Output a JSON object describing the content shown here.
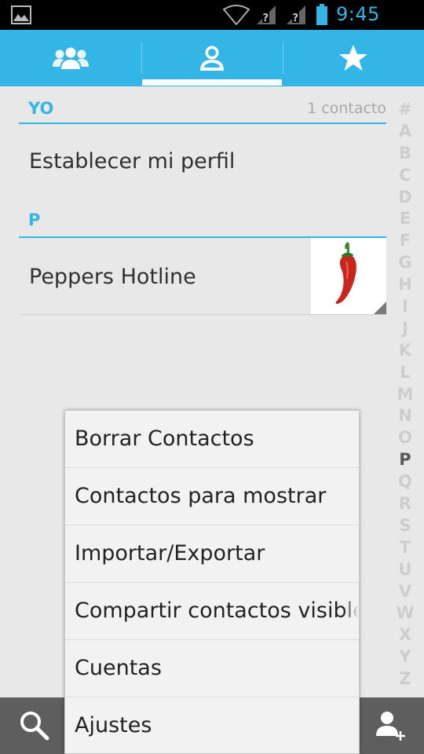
{
  "status_bar": {
    "time": "9:45 p.m.",
    "icons": [
      "gallery-icon",
      "wifi-icon",
      "signal-icon",
      "signal-icon",
      "battery-icon"
    ],
    "time_color": "#33b5e5"
  },
  "tabs": [
    {
      "name": "groups",
      "icon": "group-icon",
      "selected": false
    },
    {
      "name": "all-contacts",
      "icon": "person-icon",
      "selected": true
    },
    {
      "name": "favorites",
      "icon": "star-icon",
      "selected": false
    }
  ],
  "colors": {
    "accent": "#33b5e5",
    "bottom_bar": "#5e5e5e"
  },
  "sections": {
    "me": {
      "label": "YO",
      "count": "1 contacto",
      "item": "Establecer mi perfil"
    },
    "p": {
      "label": "P",
      "item": "Peppers Hotline"
    }
  },
  "index_letters": [
    "#",
    "A",
    "B",
    "C",
    "D",
    "E",
    "F",
    "G",
    "H",
    "I",
    "J",
    "K",
    "L",
    "M",
    "N",
    "O",
    "P",
    "Q",
    "R",
    "S",
    "T",
    "U",
    "V",
    "W",
    "X",
    "Y",
    "Z"
  ],
  "index_active": "P",
  "bottom_bar": {
    "left_icon": "search-icon",
    "right_icon": "add-contact-icon"
  },
  "menu": {
    "items": [
      "Borrar Contactos",
      "Contactos para mostrar",
      "Importar/Exportar",
      "Compartir contactos visibles",
      "Cuentas",
      "Ajustes"
    ]
  }
}
